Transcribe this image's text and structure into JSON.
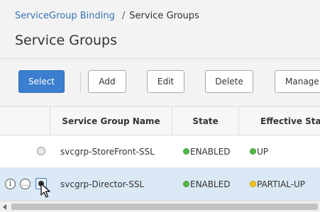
{
  "breadcrumb": {
    "parent": "ServiceGroup Binding",
    "separator": "/",
    "current": "Service Groups"
  },
  "page": {
    "title": "Service Groups"
  },
  "toolbar": {
    "select": "Select",
    "add": "Add",
    "edit": "Edit",
    "delete": "Delete",
    "manage": "Manage"
  },
  "table": {
    "headers": {
      "name": "Service Group Name",
      "state": "State",
      "effective_state": "Effective State"
    },
    "rows": [
      {
        "name": "svcgrp-StoreFront-SSL",
        "state": "ENABLED",
        "state_status": "green",
        "effective_state": "UP",
        "effective_status": "green",
        "selected": false
      },
      {
        "name": "svcgrp-Director-SSL",
        "state": "ENABLED",
        "state_status": "green",
        "effective_state": "PARTIAL-UP",
        "effective_status": "yellow",
        "selected": true
      }
    ],
    "row_icons": {
      "info": "i",
      "more": "…"
    }
  },
  "colors": {
    "link": "#3873b8",
    "primary_button": "#3c7fcf",
    "selected_row": "#dbe8f6",
    "status_green": "#52b848",
    "status_yellow": "#f2c21a"
  },
  "icons": {
    "info": "info-icon",
    "more": "more-icon",
    "cursor": "mouse-pointer-icon",
    "scroll_left": "scroll-left-arrow-icon"
  }
}
